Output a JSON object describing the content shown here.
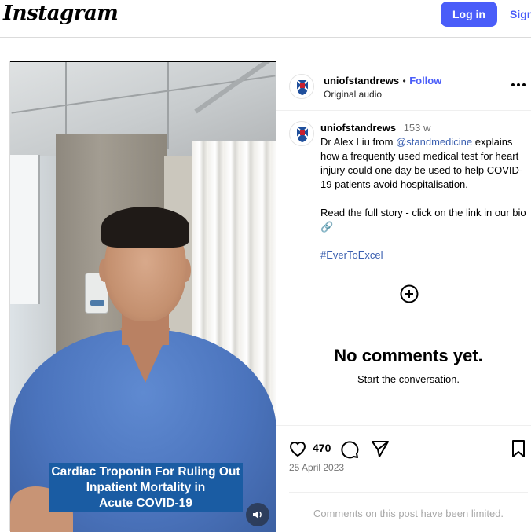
{
  "topbar": {
    "logo": "Instagram",
    "login_label": "Log in",
    "signup_label": "Sign up"
  },
  "video": {
    "caption_lines": [
      "Cardiac Troponin For Ruling Out",
      "Inpatient Mortality in",
      "Acute COVID-19"
    ],
    "volume_icon": "speaker-icon"
  },
  "post": {
    "header": {
      "username": "uniofstandrews",
      "separator": "•",
      "follow_label": "Follow",
      "audio": "Original audio",
      "more_icon": "more-options-icon"
    },
    "caption": {
      "username": "uniofstandrews",
      "age": "153 w",
      "text_before_mention": "Dr Alex Liu from ",
      "mention": "@standmedicine",
      "text_after_mention": " explains how a frequently used medical test for heart injury could one day be used to help COVID-19 patients avoid hospitalisation.",
      "paragraph2": "Read the full story - click on the link in our bio",
      "paragraph2_icon": "🔗",
      "hashtag": "#EverToExcel"
    },
    "comments": {
      "empty_title": "No comments yet.",
      "empty_subtitle": "Start the conversation."
    },
    "actions": {
      "likes": "470",
      "date": "25 April 2023",
      "limited_note": "Comments on this post have been limited."
    }
  },
  "colors": {
    "accent": "#4a5df9",
    "link": "#3a5fb0",
    "caption_bg": "#1a5ca3",
    "border": "#dbdbdb"
  }
}
